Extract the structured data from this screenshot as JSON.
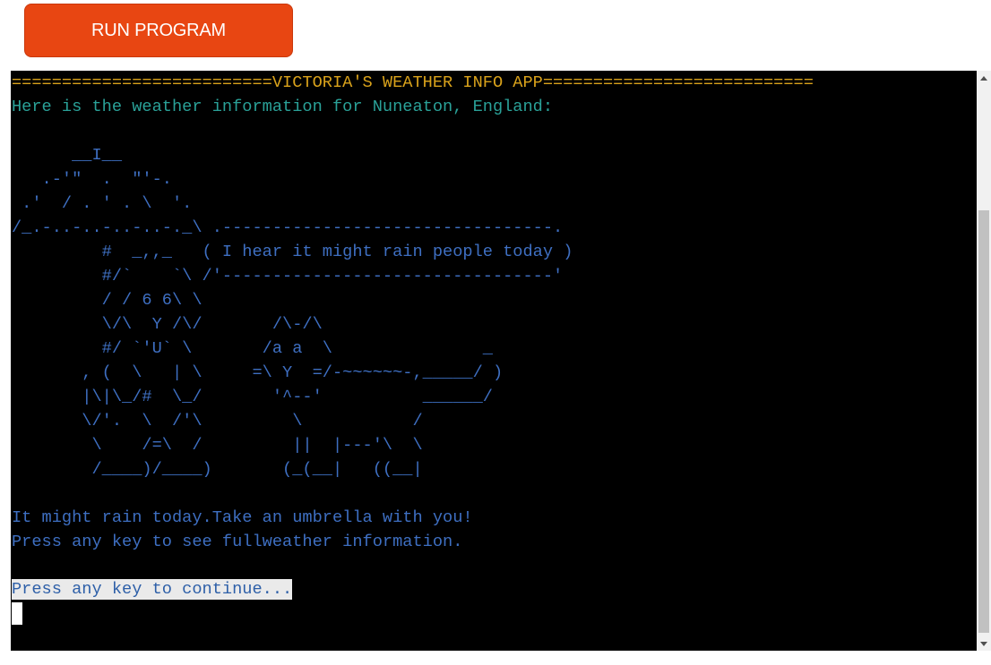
{
  "toolbar": {
    "run_label": "RUN PROGRAM"
  },
  "terminal": {
    "title_line": "==========================VICTORIA'S WEATHER INFO APP===========================",
    "location_line": "Here is the weather information for Nuneaton, England:",
    "art": [
      "      __I__",
      "   .-'\"  .  \"'-.",
      " .'  / . ' . \\  '.",
      "/_.-..-..-..-..-._\\ .---------------------------------.",
      "         #  _,,_   ( I hear it might rain people today )",
      "         #/`    `\\ /'---------------------------------'",
      "         / / 6 6\\ \\",
      "         \\/\\  Y /\\/       /\\-/\\",
      "         #/ `'U` \\       /a a  \\               _",
      "       , (  \\   | \\     =\\ Y  =/-~~~~~~-,_____/ )",
      "       |\\|\\_/#  \\_/       '^--'          ______/",
      "       \\/'.  \\  /'\\         \\           /",
      "        \\    /=\\  /         ||  |---'\\  \\",
      "        /____)/____)       (_(__|   ((__|"
    ],
    "message_line": "It might rain today.Take an umbrella with you!",
    "instruction_line": "Press any key to see fullweather information.",
    "prompt_line": "Press any key to continue..."
  },
  "colors": {
    "button_bg": "#e84612",
    "terminal_bg": "#000000",
    "title": "#d9a21b",
    "cyan_text": "#2aa198",
    "blue_text": "#3e6fc2"
  },
  "icons": {
    "scroll_up": "triangle-up-icon",
    "scroll_down": "triangle-down-icon"
  }
}
